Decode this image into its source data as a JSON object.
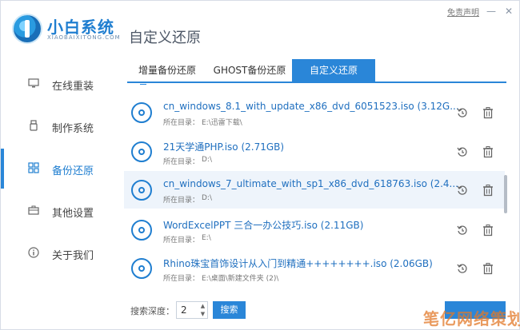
{
  "window": {
    "brand_name": "小白系统",
    "brand_sub": "XIAOBAIXITONG.COM",
    "page_title": "自定义还原",
    "disclaimer": "免责声明",
    "minimize": "—",
    "close": "✕"
  },
  "sidebar": {
    "items": [
      {
        "label": "在线重装",
        "icon": "monitor-icon"
      },
      {
        "label": "制作系统",
        "icon": "usb-icon"
      },
      {
        "label": "备份还原",
        "icon": "backup-icon"
      },
      {
        "label": "其他设置",
        "icon": "toolbox-icon"
      },
      {
        "label": "关于我们",
        "icon": "info-icon"
      }
    ],
    "active_index": 2
  },
  "tabs": [
    {
      "label": "增量备份还原"
    },
    {
      "label": "GHOST备份还原"
    },
    {
      "label": "自定义还原",
      "active": true
    }
  ],
  "list": {
    "dir_label": "所在目录：",
    "rows": [
      {
        "title": "cn_windows_8.1_with_update_x86_dvd_6051523.iso (3.12G...",
        "dir": "E:\\迅雷下载\\"
      },
      {
        "title": "21天学通PHP.iso (2.71GB)",
        "dir": "D:\\"
      },
      {
        "title": "cn_windows_7_ultimate_with_sp1_x86_dvd_618763.iso (2.4...",
        "dir": "D:\\",
        "selected": true
      },
      {
        "title": "WordExcelPPT 三合一办公技巧.iso (2.11GB)",
        "dir": "E:\\"
      },
      {
        "title": "Rhino珠宝首饰设计从入门到精通++++++++.iso (2.06GB)",
        "dir": "E:\\桌面\\新建文件夹 (2)\\"
      }
    ]
  },
  "bottom": {
    "depth_label": "搜索深度：",
    "depth_value": "2",
    "search_button": "搜索"
  },
  "watermark": "笔亿网络策划",
  "colors": {
    "accent": "#2a86d8",
    "title_text": "#1f6fbf",
    "selected_row": "#eef4fb"
  }
}
